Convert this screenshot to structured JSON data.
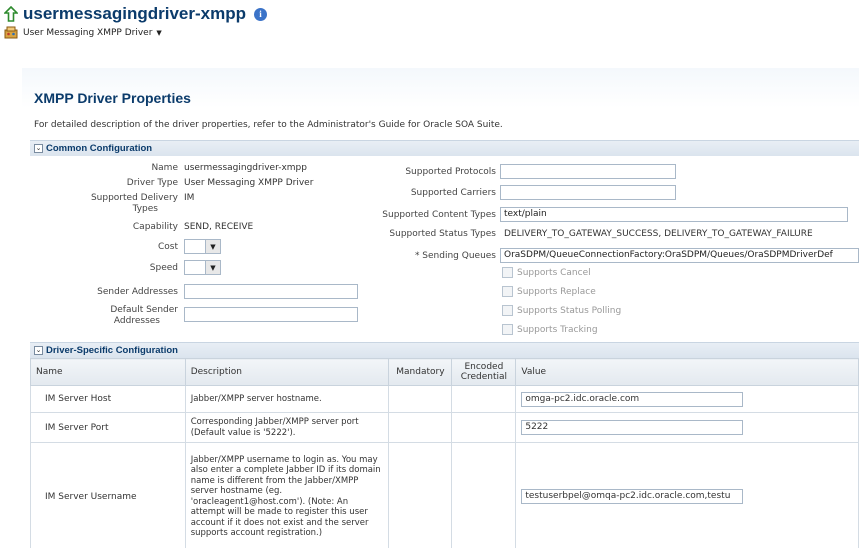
{
  "header": {
    "title": "usermessagingdriver-xmpp",
    "info_glyph": "i",
    "driver_menu_label": "User Messaging XMPP Driver",
    "driver_menu_caret": "▼"
  },
  "properties": {
    "section_title": "XMPP Driver Properties",
    "description": "For detailed description of the driver properties, refer to the Administrator's Guide for Oracle SOA Suite."
  },
  "common": {
    "group_title": "Common Configuration",
    "toggle_glyph": "⌄",
    "name_label": "Name",
    "name_value": "usermessagingdriver-xmpp",
    "driver_type_label": "Driver Type",
    "driver_type_value": "User Messaging XMPP Driver",
    "supported_delivery_types_label_1": "Supported Delivery",
    "supported_delivery_types_label_2": "Types",
    "supported_delivery_types_value": "IM",
    "capability_label": "Capability",
    "capability_value": "SEND, RECEIVE",
    "cost_label": "Cost",
    "speed_label": "Speed",
    "select_arrow": "▼",
    "sender_addresses_label": "Sender Addresses",
    "sender_addresses_value": "",
    "default_sender_label_1": "Default Sender",
    "default_sender_label_2": "Addresses",
    "default_sender_value": "",
    "supported_protocols_label": "Supported Protocols",
    "supported_protocols_value": "",
    "supported_carriers_label": "Supported Carriers",
    "supported_carriers_value": "",
    "supported_content_types_label": "Supported Content Types",
    "supported_content_types_value": "text/plain",
    "supported_status_types_label": "Supported Status Types",
    "supported_status_types_value": "DELIVERY_TO_GATEWAY_SUCCESS, DELIVERY_TO_GATEWAY_FAILURE",
    "sending_queues_label": "* Sending Queues",
    "sending_queues_value": "OraSDPM/QueueConnectionFactory:OraSDPM/Queues/OraSDPMDriverDef",
    "checkboxes": [
      {
        "label": "Supports Cancel"
      },
      {
        "label": "Supports Replace"
      },
      {
        "label": "Supports Status Polling"
      },
      {
        "label": "Supports Tracking"
      }
    ]
  },
  "driver_specific": {
    "group_title": "Driver-Specific Configuration",
    "toggle_glyph": "⌄",
    "columns": {
      "name": "Name",
      "description": "Description",
      "mandatory": "Mandatory",
      "encoded_credential_1": "Encoded",
      "encoded_credential_2": "Credential",
      "value": "Value"
    },
    "rows": [
      {
        "name": "IM Server Host",
        "description": "Jabber/XMPP server hostname.",
        "value": "omga-pc2.idc.oracle.com"
      },
      {
        "name": "IM Server Port",
        "description": "Corresponding Jabber/XMPP server port (Default value is '5222').",
        "value": "5222"
      },
      {
        "name": "IM Server Username",
        "description": "Jabber/XMPP username to login as. You may also enter a complete Jabber ID if its domain name is different from the Jabber/XMPP server hostname (eg. 'oracleagent1@host.com'). (Note: An attempt will be made to register this user account if it does not exist and the server supports account registration.)",
        "value": "testuserbpel@omqa-pc2.idc.oracle.com,testu"
      }
    ]
  }
}
